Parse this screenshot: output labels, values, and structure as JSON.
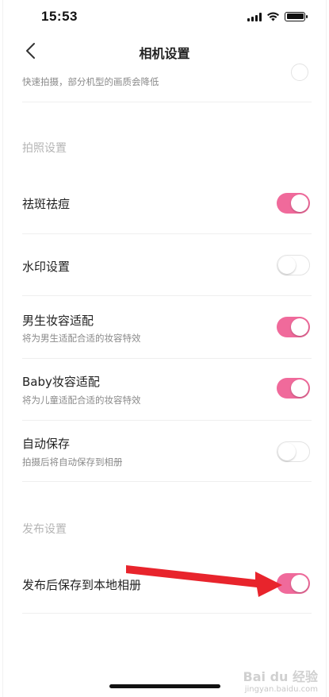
{
  "status_bar": {
    "time": "15:53",
    "icons": [
      "signal-icon",
      "wifi-icon",
      "battery-icon"
    ]
  },
  "nav": {
    "back_icon": "chevron-left-icon",
    "title": "相机设置"
  },
  "top_partial_row": {
    "subtitle": "快速拍摄，部分机型的画质会降低",
    "toggle_on": false
  },
  "sections": {
    "photo_header": "拍照设置",
    "publish_header": "发布设置"
  },
  "settings": [
    {
      "title": "祛斑祛痘",
      "subtitle": "",
      "on": true
    },
    {
      "title": "水印设置",
      "subtitle": "",
      "on": false
    },
    {
      "title": "男生妆容适配",
      "subtitle": "将为男生适配合适的妆容特效",
      "on": true
    },
    {
      "title": "Baby妆容适配",
      "subtitle": "将为儿童适配合适的妆容特效",
      "on": true
    },
    {
      "title": "自动保存",
      "subtitle": "拍摄后将自动保存到相册",
      "on": false
    },
    {
      "title": "发布后保存到本地相册",
      "subtitle": "",
      "on": true
    }
  ],
  "colors": {
    "toggle_on": "#f06a9b",
    "toggle_off_border": "#e3e3e3",
    "annotation_arrow": "#e8242c"
  },
  "watermark": {
    "main": "Bai du 经验",
    "sub": "jingyan.baidu.com"
  }
}
